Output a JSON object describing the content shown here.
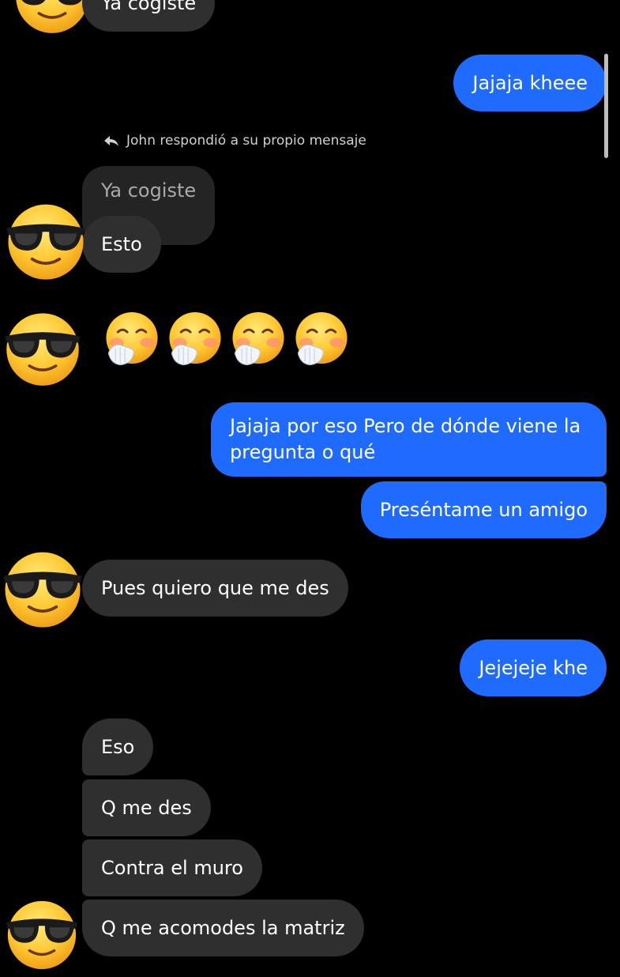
{
  "colors": {
    "background": "#000000",
    "incoming_bubble": "#2f2f2f",
    "outgoing_bubble": "#1f6bff",
    "quoted_text": "#a9a9a9"
  },
  "avatar_icon": "smiling-face-with-sunglasses",
  "reaction_icon": "face-with-hand-over-mouth",
  "messages": {
    "m0": "Ya cogiste",
    "m1": "Jajaja kheee",
    "reply_note": "John respondió a su propio mensaje",
    "m2_quoted": "Ya cogiste",
    "m3": "Esto",
    "m4": "Jajaja por eso Pero de dónde viene la pregunta o qué",
    "m5": "Preséntame un amigo",
    "m6": "Pues quiero que me des",
    "m7": "Jejejeje khe",
    "m8": "Eso",
    "m9": "Q me des",
    "m10": "Contra el muro",
    "m11": "Q me acomodes la matriz"
  }
}
